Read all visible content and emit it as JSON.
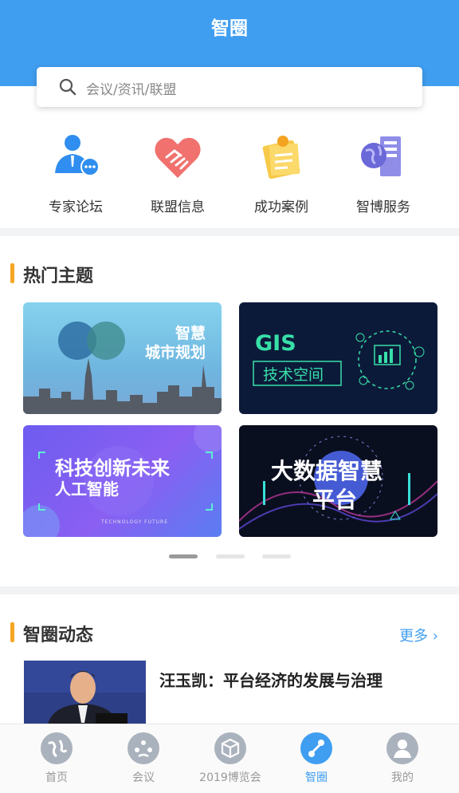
{
  "header": {
    "title": "智圈"
  },
  "search": {
    "placeholder": "会议/资讯/联盟"
  },
  "quick_links": [
    {
      "label": "专家论坛",
      "icon": "expert-person-icon"
    },
    {
      "label": "联盟信息",
      "icon": "handshake-heart-icon"
    },
    {
      "label": "成功案例",
      "icon": "clipboard-notes-icon"
    },
    {
      "label": "智博服务",
      "icon": "globe-building-icon"
    }
  ],
  "hot_topics": {
    "title": "热门主题",
    "cards": [
      {
        "text_line1": "智慧",
        "text_line2": "城市规划"
      },
      {
        "text_line1": "GIS",
        "text_line2": "技术空间"
      },
      {
        "text_line1": "科技创新未来",
        "text_line2": "人工智能",
        "caption": "TECHNOLOGY FUTURE"
      },
      {
        "text_line1": "大数据智慧",
        "text_line2": "平台"
      }
    ],
    "carousel_pages": 3,
    "carousel_active": 1
  },
  "news": {
    "title": "智圈动态",
    "more": "更多",
    "items": [
      {
        "title": "汪玉凯：平台经济的发展与治理"
      }
    ]
  },
  "tabbar": [
    {
      "label": "首页",
      "icon": "globe-icon"
    },
    {
      "label": "会议",
      "icon": "meeting-icon"
    },
    {
      "label": "2019博览会",
      "icon": "cube-icon"
    },
    {
      "label": "智圈",
      "icon": "circle-link-icon",
      "active": true
    },
    {
      "label": "我的",
      "icon": "user-icon"
    }
  ],
  "colors": {
    "primary": "#409ef0",
    "accent": "#f6a623"
  }
}
